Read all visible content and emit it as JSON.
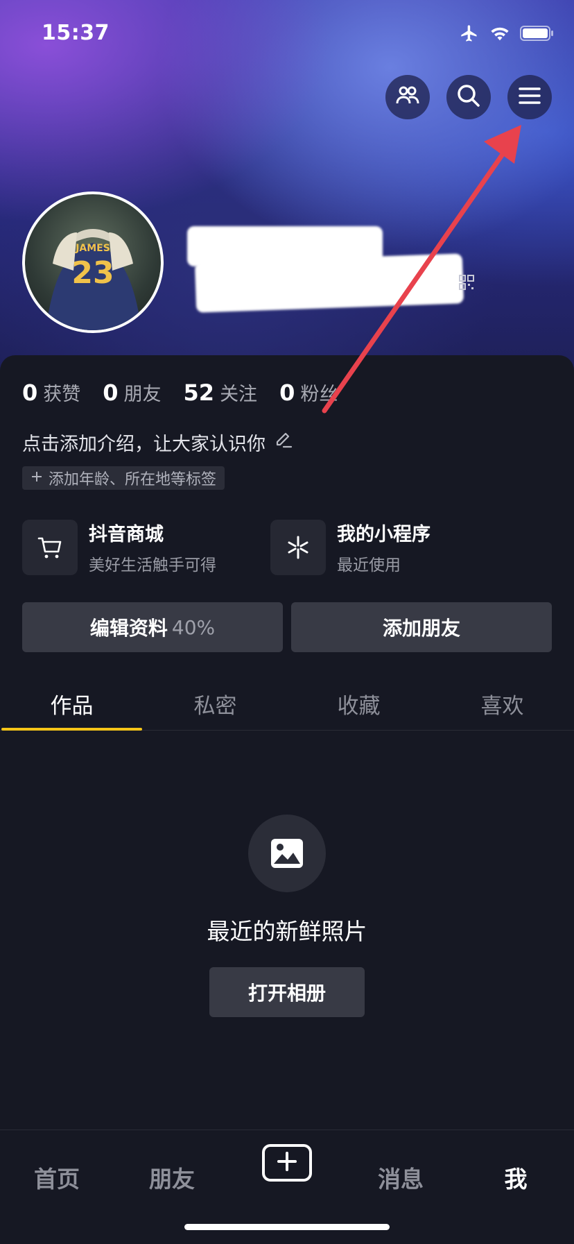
{
  "status_bar": {
    "time": "15:37"
  },
  "profile": {
    "stats": [
      {
        "num": "0",
        "label": "获赞"
      },
      {
        "num": "0",
        "label": "朋友"
      },
      {
        "num": "52",
        "label": "关注"
      },
      {
        "num": "0",
        "label": "粉丝"
      }
    ],
    "bio": "点击添加介绍，让大家认识你",
    "tag": "添加年龄、所在地等标签"
  },
  "services": [
    {
      "title": "抖音商城",
      "subtitle": "美好生活触手可得"
    },
    {
      "title": "我的小程序",
      "subtitle": "最近使用"
    }
  ],
  "actions": {
    "edit_label": "编辑资料",
    "edit_percent": "40%",
    "add_friend_label": "添加朋友"
  },
  "tabs": [
    "作品",
    "私密",
    "收藏",
    "喜欢"
  ],
  "empty_state": {
    "title": "最近的新鲜照片",
    "button": "打开相册"
  },
  "bottom_nav": [
    "首页",
    "朋友",
    "消息",
    "我"
  ],
  "colors": {
    "accent": "#f5c518",
    "annotation_arrow": "#e8424d",
    "background": "#161823"
  },
  "icons": [
    "airplane-icon",
    "wifi-icon",
    "battery-icon",
    "friends-icon",
    "search-icon",
    "menu-icon",
    "edit-icon",
    "cart-icon",
    "mini-program-icon",
    "image-icon",
    "plus-icon",
    "qr-code-icon"
  ]
}
